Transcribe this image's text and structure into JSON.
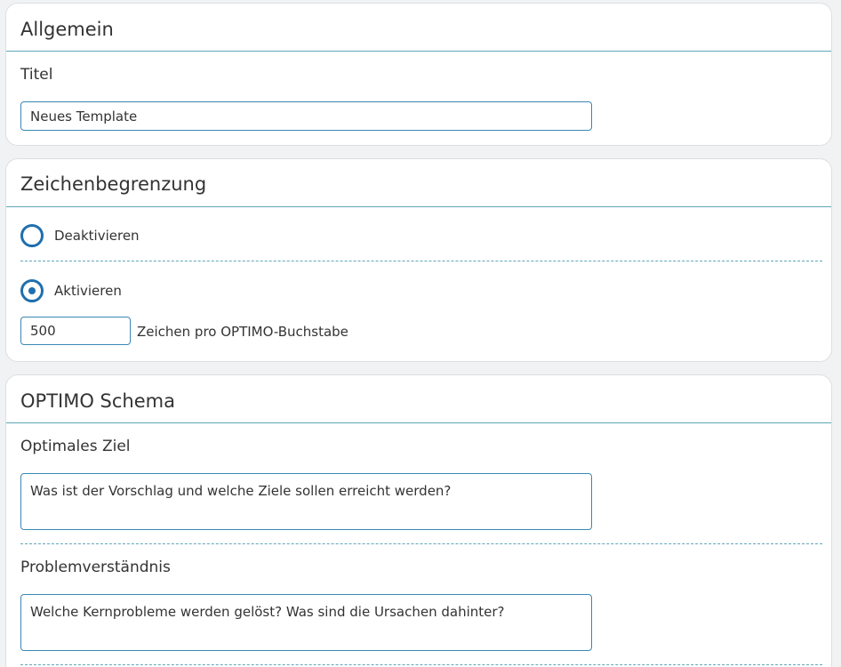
{
  "sections": {
    "general": {
      "title": "Allgemein",
      "title_field": {
        "label": "Titel",
        "value": "Neues Template"
      }
    },
    "char_limit": {
      "title": "Zeichenbegrenzung",
      "options": [
        {
          "label": "Deaktivieren",
          "selected": false
        },
        {
          "label": "Aktivieren",
          "selected": true
        }
      ],
      "limit_value": "500",
      "limit_suffix": "Zeichen pro OPTIMO-Buchstabe"
    },
    "optimo": {
      "title": "OPTIMO Schema",
      "fields": [
        {
          "label": "Optimales Ziel",
          "placeholder": "Was ist der Vorschlag und welche Ziele sollen erreicht werden?"
        },
        {
          "label": "Problemverständnis",
          "placeholder": "Welche Kernprobleme werden gelöst? Was sind die Ursachen dahinter?"
        }
      ]
    }
  },
  "colors": {
    "accent": "#1f6fae",
    "rule": "#5fa7b6",
    "input_border": "#3a88b3"
  }
}
